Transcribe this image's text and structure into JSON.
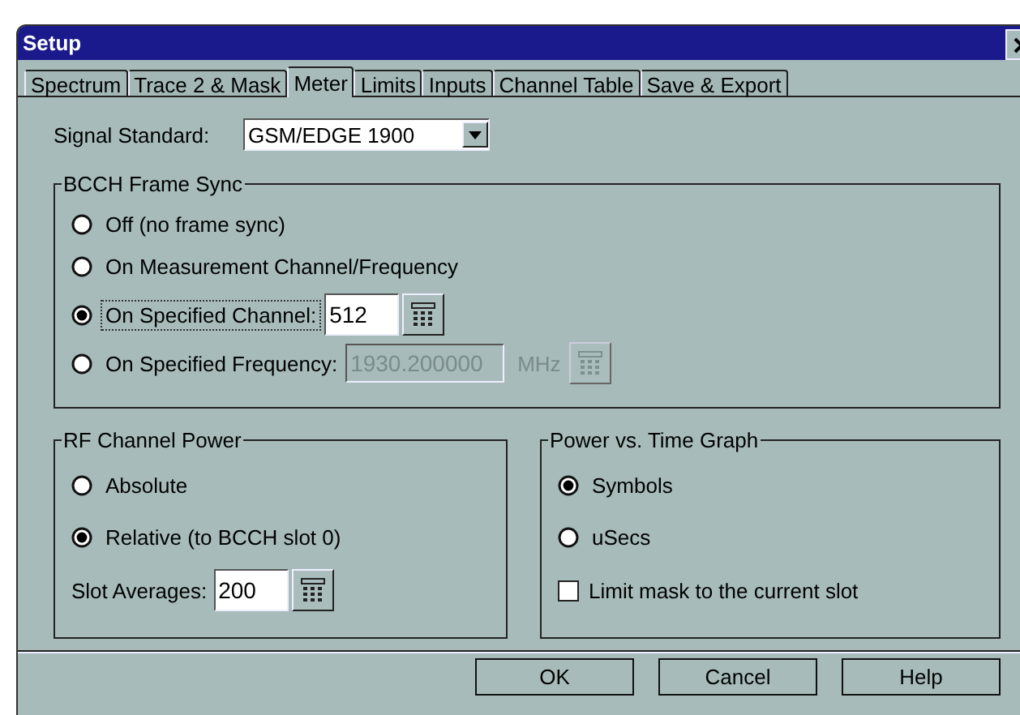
{
  "window": {
    "title": "Setup"
  },
  "tabs": [
    {
      "label": "Spectrum",
      "selected": false
    },
    {
      "label": "Trace 2 & Mask",
      "selected": false
    },
    {
      "label": "Meter",
      "selected": true
    },
    {
      "label": "Limits",
      "selected": false
    },
    {
      "label": "Inputs",
      "selected": false
    },
    {
      "label": "Channel Table",
      "selected": false
    },
    {
      "label": "Save & Export",
      "selected": false
    }
  ],
  "signal_standard": {
    "label": "Signal Standard:",
    "value": "GSM/EDGE 1900"
  },
  "bcch_frame_sync": {
    "title": "BCCH Frame Sync",
    "options": [
      {
        "label": "Off (no frame sync)",
        "selected": false,
        "focused": false
      },
      {
        "label": "On Measurement Channel/Frequency",
        "selected": false,
        "focused": false
      },
      {
        "label": "On Specified Channel:",
        "selected": true,
        "focused": true,
        "field": {
          "value": "512",
          "disabled": false
        }
      },
      {
        "label": "On Specified Frequency:",
        "selected": false,
        "focused": false,
        "field": {
          "value": "1930.200000",
          "disabled": true
        },
        "unit": "MHz"
      }
    ]
  },
  "rf_channel_power": {
    "title": "RF Channel Power",
    "options": [
      {
        "label": "Absolute",
        "selected": false
      },
      {
        "label": "Relative (to BCCH slot 0)",
        "selected": true
      }
    ],
    "slot_averages": {
      "label": "Slot Averages:",
      "value": "200"
    }
  },
  "power_vs_time_graph": {
    "title": "Power vs. Time Graph",
    "options": [
      {
        "label": "Symbols",
        "selected": true
      },
      {
        "label": "uSecs",
        "selected": false
      }
    ],
    "limit_mask": {
      "label": "Limit mask to the current slot",
      "checked": false
    }
  },
  "buttons": [
    "OK",
    "Cancel",
    "Help"
  ]
}
